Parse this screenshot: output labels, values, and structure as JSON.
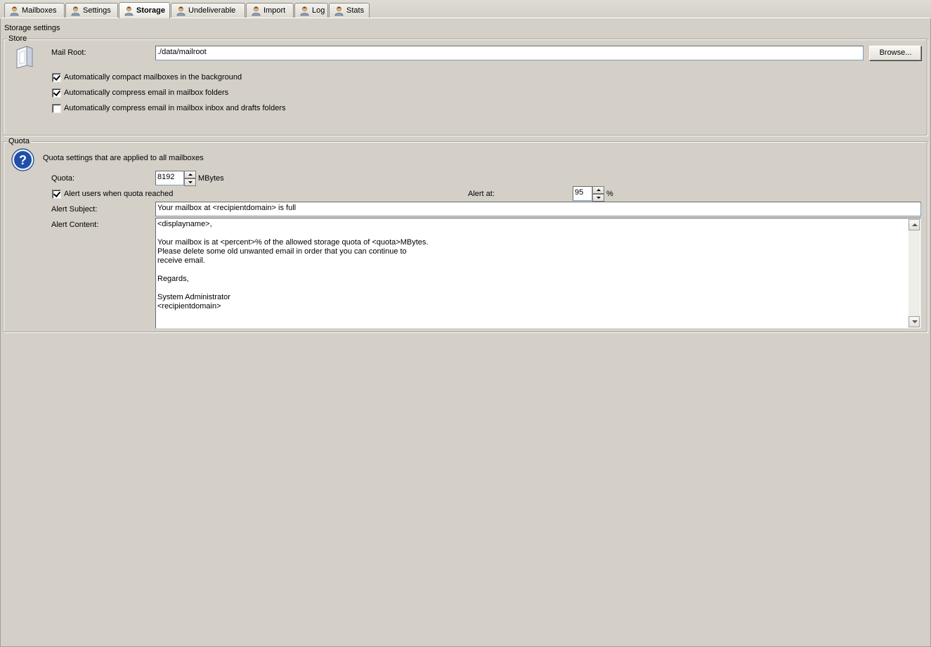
{
  "tabs": [
    {
      "label": "Mailboxes",
      "active": false
    },
    {
      "label": "Settings",
      "active": false
    },
    {
      "label": "Storage",
      "active": true
    },
    {
      "label": "Undeliverable",
      "active": false
    },
    {
      "label": "Import",
      "active": false
    },
    {
      "label": "Log",
      "active": false
    },
    {
      "label": "Stats",
      "active": false
    }
  ],
  "page_heading": "Storage settings",
  "store": {
    "legend": "Store",
    "mail_root_label": "Mail Root:",
    "mail_root_value": "./data/mailroot",
    "browse_label": "Browse...",
    "options": [
      {
        "label": "Automatically compact mailboxes in the background",
        "checked": true
      },
      {
        "label": "Automatically compress email in mailbox folders",
        "checked": true
      },
      {
        "label": "Automatically compress email in mailbox inbox and drafts folders",
        "checked": false
      }
    ]
  },
  "quota": {
    "legend": "Quota",
    "description": "Quota settings that are applied to all mailboxes",
    "quota_label": "Quota:",
    "quota_value": "8192",
    "quota_unit": "MBytes",
    "alert_users_label": "Alert users when quota reached",
    "alert_users_checked": true,
    "alert_at_label": "Alert at:",
    "alert_at_value": "95",
    "alert_at_unit": "%",
    "alert_subject_label": "Alert Subject:",
    "alert_subject_value": "Your mailbox at <recipientdomain> is full",
    "alert_content_label": "Alert Content:",
    "alert_content_value": "<displayname>,\n\nYour mailbox is at <percent>% of the allowed storage quota of <quota>MBytes.\nPlease delete some old unwanted email in order that you can continue to\nreceive email.\n\nRegards,\n\nSystem Administrator\n<recipientdomain>"
  },
  "colors": {
    "window_bg": "#d4d0c8",
    "input_border": "#7f9db9",
    "help_icon": "#1f4fa8"
  }
}
